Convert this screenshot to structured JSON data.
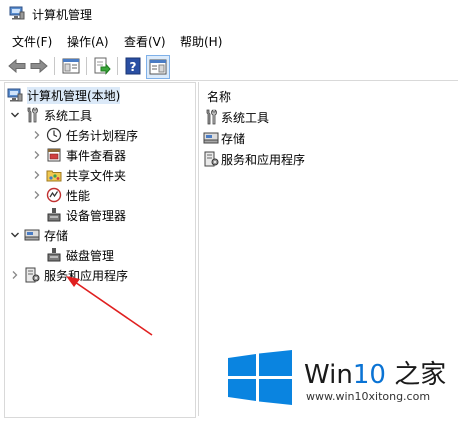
{
  "window": {
    "title": "计算机管理"
  },
  "menu": [
    "文件(F)",
    "操作(A)",
    "查看(V)",
    "帮助(H)"
  ],
  "tree": {
    "root": "计算机管理(本地)",
    "system_tools": "系统工具",
    "task_scheduler": "任务计划程序",
    "event_viewer": "事件查看器",
    "shared_folders": "共享文件夹",
    "performance": "性能",
    "device_manager": "设备管理器",
    "storage": "存储",
    "disk_management": "磁盘管理",
    "services_apps": "服务和应用程序"
  },
  "list": {
    "column_name": "名称",
    "items": [
      "系统工具",
      "存储",
      "服务和应用程序"
    ]
  },
  "watermark": {
    "brand_win": "Win",
    "brand_num": "10",
    "brand_rest": " 之家",
    "url": "www.win10xitong.com"
  },
  "colors": {
    "accent": "#0a73d4",
    "arrow": "#e02020"
  }
}
